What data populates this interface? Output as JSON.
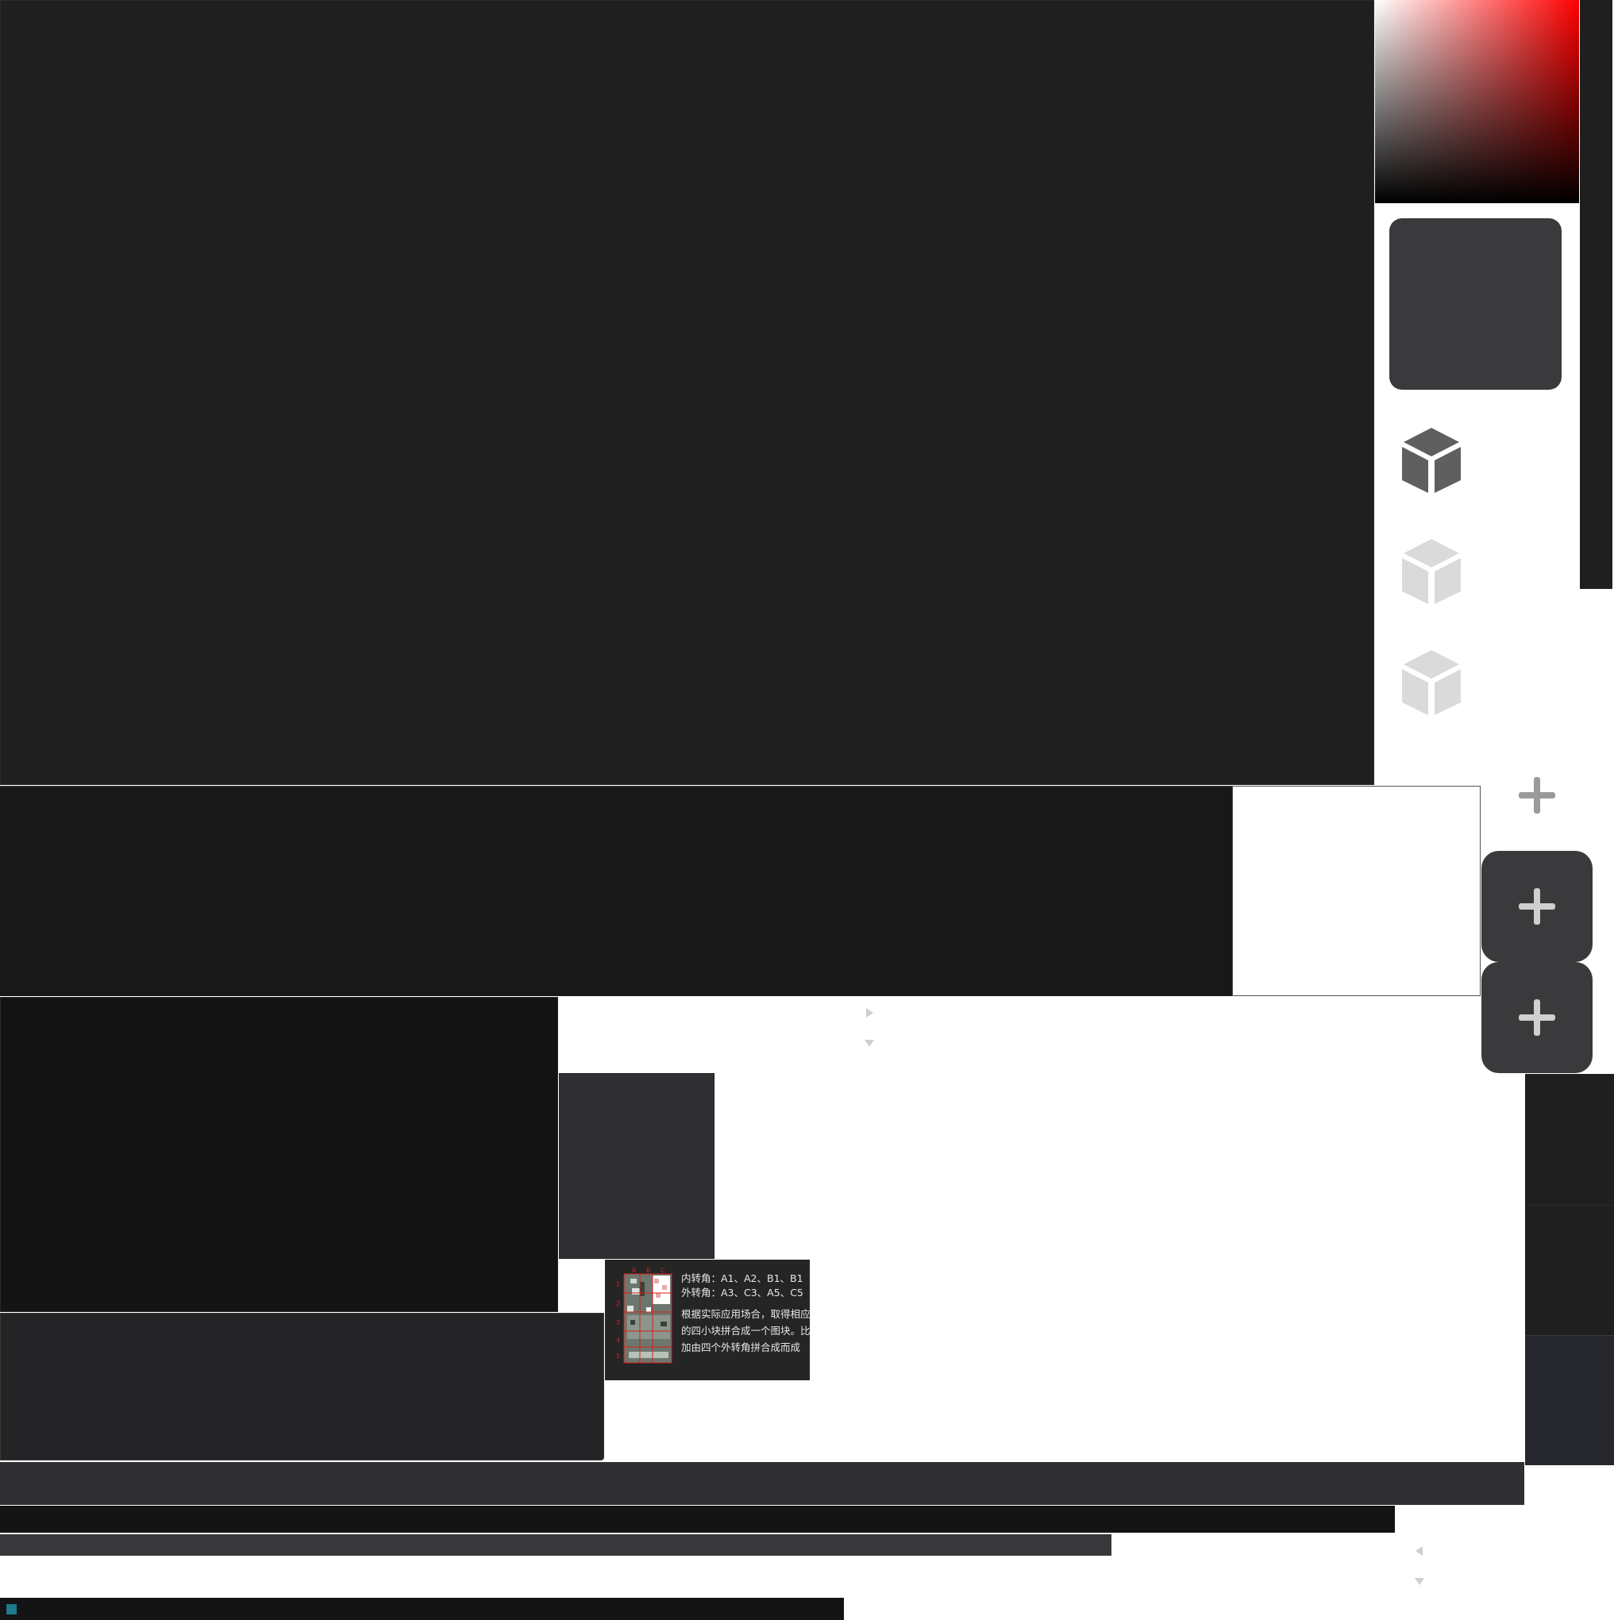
{
  "colors": {
    "canvas": "#1f1f1f",
    "accent_indicator": "#1e7a8c",
    "picker_hue": "#ff0000"
  },
  "color_picker": {
    "hue": "red"
  },
  "toolbar_icons": [
    "cube-icon",
    "cube-icon",
    "cube-icon",
    "plus-icon",
    "plus-icon",
    "plus-icon"
  ],
  "tooltip": {
    "grid_columns": [
      "A",
      "B",
      "C"
    ],
    "grid_rows": [
      "1",
      "2",
      "3",
      "4",
      "5"
    ],
    "line1": "内转角：A1、A2、B1、B1",
    "line2": "外转角：A3、C3、A5、C5",
    "line3": "根据实际应用场合，取得相应",
    "line4": "的四小块拼合成一个图块。比",
    "line5": "加由四个外转角拼合成而成"
  }
}
